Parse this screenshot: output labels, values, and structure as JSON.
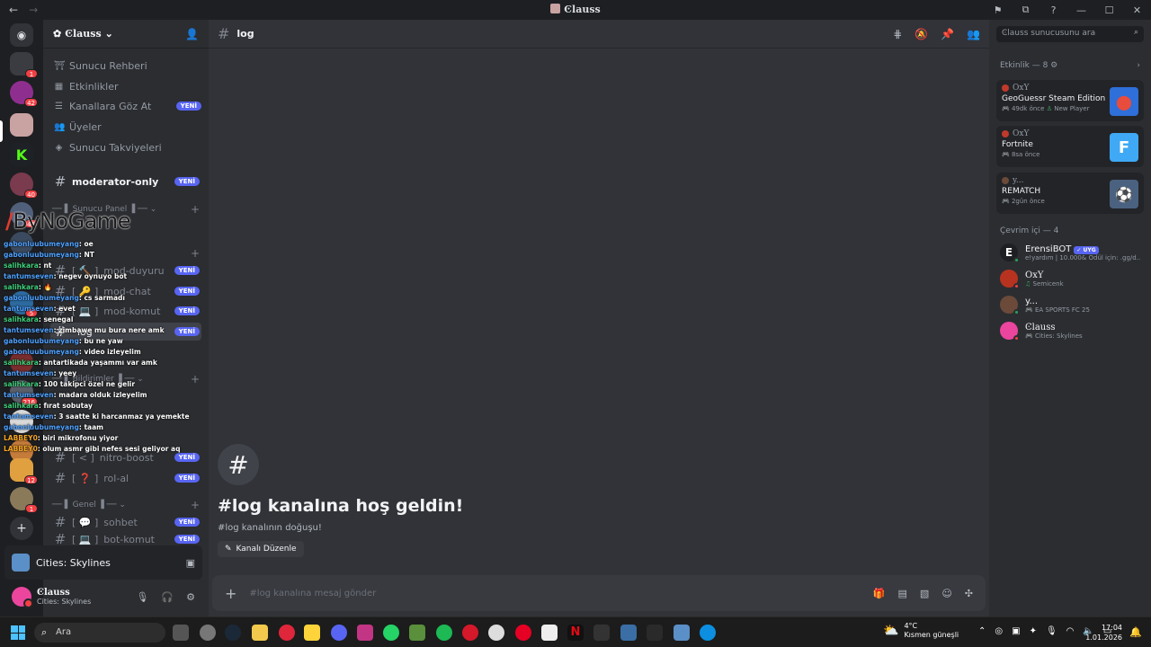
{
  "window": {
    "title": "Ͼlauss"
  },
  "server": {
    "name": "Ͼlauss",
    "menu": [
      {
        "label": "Sunucu Rehberi",
        "icon": "guide-icon"
      },
      {
        "label": "Etkinlikler",
        "icon": "calendar-icon"
      },
      {
        "label": "Kanallara Göz At",
        "icon": "browse-channels-icon",
        "badge": "YENİ"
      },
      {
        "label": "Üyeler",
        "icon": "members-icon"
      },
      {
        "label": "Sunucu Takviyeleri",
        "icon": "boost-icon"
      }
    ],
    "top_channel": {
      "name": "moderator-only",
      "badge": "YENİ"
    },
    "categories": {
      "panel": "Sunucu Panel",
      "bildirim": "Bildirimler",
      "genel": "Genel"
    },
    "channels": [
      {
        "name": "mod-duyuru",
        "prefix": "[ 🔨 ]",
        "badge": "YENİ"
      },
      {
        "name": "mod-chat",
        "prefix": "[ 🔑 ]",
        "badge": "YENİ"
      },
      {
        "name": "mod-komut",
        "prefix": "[ 💻 ]",
        "badge": "YENİ"
      },
      {
        "name": "log",
        "prefix": "",
        "badge": "YENİ"
      },
      {
        "name": "nitro-boost",
        "prefix": "[ < ]",
        "badge": "YENİ"
      },
      {
        "name": "rol-al",
        "prefix": "[ ❓ ]",
        "badge": "YENİ"
      },
      {
        "name": "sohbet",
        "prefix": "[ 💬 ]",
        "badge": "YENİ"
      },
      {
        "name": "bot-komut",
        "prefix": "[ 💻 ]",
        "badge": "YENİ"
      }
    ],
    "rail_badges": [
      "1",
      "42",
      "40",
      "41",
      "5",
      "216",
      "12",
      "1"
    ]
  },
  "overlay": {
    "brand": "ByNoGame",
    "messages": [
      {
        "user": "gabonluubumeyang",
        "text": "oe"
      },
      {
        "user": "gabonluubumeyang",
        "text": "NT"
      },
      {
        "user": "salihkara",
        "text": "nt"
      },
      {
        "user": "tantumseven",
        "text": "negev oynuyo bot"
      },
      {
        "user": "salihkara",
        "text": "🔥"
      },
      {
        "user": "gabonluubumeyang",
        "text": "cs sarmadı"
      },
      {
        "user": "tantumseven",
        "text": "evet"
      },
      {
        "user": "salihkara",
        "text": "senegal"
      },
      {
        "user": "tantumseven",
        "text": "zimbawe mu bura nere amk"
      },
      {
        "user": "gabonluubumeyang",
        "text": "bu ne yaw"
      },
      {
        "user": "gabonluubumeyang",
        "text": "video izleyelim"
      },
      {
        "user": "salihkara",
        "text": "antartikada yaşammı var amk"
      },
      {
        "user": "tantumseven",
        "text": "yeey"
      },
      {
        "user": "salihkara",
        "text": "100 takipci özel ne gelir"
      },
      {
        "user": "tantumseven",
        "text": "madara olduk izleyelim"
      },
      {
        "user": "salihkara",
        "text": "fırat sobutay"
      },
      {
        "user": "tantumseven",
        "text": "3 saatte ki harcanmaz ya yemekte"
      },
      {
        "user": "gabonluubumeyang",
        "text": "taam"
      },
      {
        "user": "LABBEY0",
        "text": "biri mikrofonu yiyor"
      },
      {
        "user": "LABBEY0",
        "text": "olum asmr gibi nefes sesi geliyor aq"
      }
    ]
  },
  "activity_panel": {
    "label": "Cities: Skylines"
  },
  "user_panel": {
    "name": "Ͼlauss",
    "status": "Cities: Skylines"
  },
  "main": {
    "channel_name": "log",
    "welcome_title": "#log kanalına hoş geldin!",
    "welcome_sub": "#log kanalının doğuşu!",
    "edit_button": "Kanalı Düzenle",
    "composer_placeholder": "#log kanalına mesaj gönder"
  },
  "right_panel": {
    "search_placeholder": "Ͼlauss sunucusunu ara",
    "activity_header": "Etkinlik — 8",
    "cards": [
      {
        "user": "OxY",
        "game": "GeoGuessr Steam Edition",
        "time": "49dk önce",
        "extra": "New Player",
        "thumb_color": "#2e6fd9"
      },
      {
        "user": "OxY",
        "game": "Fortnite",
        "time": "8sa önce",
        "extra": "",
        "thumb_color": "#3fa9f5"
      },
      {
        "user": "y...",
        "game": "REMATCH",
        "time": "2gün önce",
        "extra": "",
        "thumb_color": "#4a6280"
      }
    ],
    "online_header": "Çevrim içi — 4",
    "members": [
      {
        "name": "ErensiBOT",
        "tag": "UYG",
        "sub": "e!yardım | 10.000& Ödül için: .gg/d...",
        "status_color": "#23a55a",
        "av_color": "#1e1f22"
      },
      {
        "name": "OxY",
        "tag": "",
        "sub": "Semicenk",
        "status_color": "#f23f43",
        "av_color": "#b8331f"
      },
      {
        "name": "y...",
        "tag": "",
        "sub": "EA SPORTS FC 25",
        "status_color": "#23a55a",
        "av_color": "#6b4a3a"
      },
      {
        "name": "Ͼlauss",
        "tag": "",
        "sub": "Cities: Skylines",
        "status_color": "#f23f43",
        "av_color": "#eb459e"
      }
    ]
  },
  "taskbar": {
    "search": "Ara",
    "weather_temp": "4°C",
    "weather_text": "Kısmen güneşli",
    "time": "17:04",
    "date": "1.01.2026"
  }
}
